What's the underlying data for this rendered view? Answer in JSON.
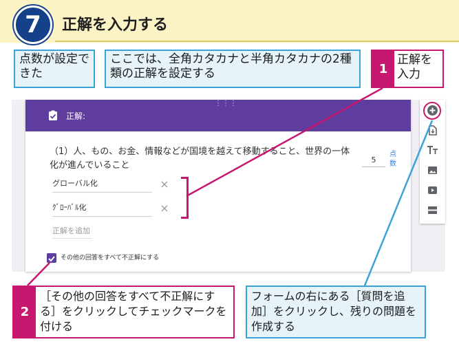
{
  "header": {
    "step_number": "7",
    "title": "正解を入力する"
  },
  "callouts": {
    "points_set": "点数が設定できた",
    "correct_answers_note": "ここでは、全角カタカナと半角カタカナの2種類の正解を設定する",
    "step1": {
      "number": "1",
      "text": "正解を入力"
    },
    "step2": {
      "number": "2",
      "text": "［その他の回答をすべて不正解にする］をクリックしてチェックマークを付ける"
    },
    "add_question_note": "フォームの右にある［質問を追加］をクリックし、残りの問題を作成する"
  },
  "form": {
    "drag_handle": "⋮⋮⋮",
    "header_label": "正解:",
    "question_text": "（1）人、もの、お金、情報などが国境を越えて移動すること、世界の一体化が進んでいること",
    "points_value": "5",
    "points_label": "点数",
    "answers": [
      "グローバル化",
      "ｸﾞﾛｰﾊﾞﾙ化"
    ],
    "remove_symbol": "×",
    "add_answer_placeholder": "正解を追加",
    "mark_others_incorrect": "その他の回答をすべて不正解にする"
  },
  "toolbar": {
    "icons": [
      "add-question-icon",
      "import-questions-icon",
      "add-title-icon",
      "add-image-icon",
      "add-video-icon",
      "add-section-icon"
    ]
  },
  "colors": {
    "accent_pink": "#c8176f",
    "accent_blue": "#3aa3d9",
    "form_purple": "#5e3d9e",
    "step_navy": "#14418a",
    "header_yellow": "#fbf3c4"
  }
}
